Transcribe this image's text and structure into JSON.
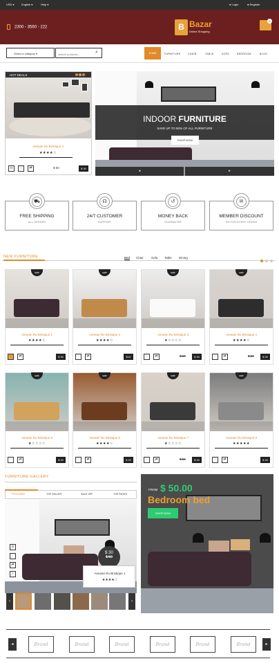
{
  "topbar": {
    "currency": "USD",
    "language": "English",
    "help": "Help",
    "login": "Login",
    "register": "Register"
  },
  "header": {
    "phone": "2300 - 3560 - 222",
    "logo_letter": "B",
    "logo_title": "Bazar",
    "logo_sub": "Online Shopping",
    "cart_count": "0"
  },
  "search": {
    "category": "Select a category",
    "placeholder": "search products..."
  },
  "nav": [
    "HOME",
    "FURNITURE",
    "CHAIR",
    "TABLE",
    "SOFA",
    "BEDROOM",
    "BLOG"
  ],
  "hot_deals": {
    "label": "HOT DEALS",
    "product": "Aenean Ru Bristique 4",
    "stars": "★★★★☆",
    "old_price": "$ 50",
    "price": "$ 30"
  },
  "banner": {
    "title_light": "INDOOR ",
    "title_bold": "FURNITURE",
    "subtitle": "SAVE UP TO 50% OF ALL FURNITURE",
    "button": "SHOP NOW",
    "prev": "◂",
    "next": "▸"
  },
  "features": [
    {
      "icon": "truck-icon",
      "glyph": "⛟",
      "title": "FREE SHIPPING",
      "sub": "ALL ORDERS"
    },
    {
      "icon": "headset-icon",
      "glyph": "☊",
      "title": "24/7 CUSTOMER",
      "sub": "SUPPORT"
    },
    {
      "icon": "refund-icon",
      "glyph": "↺",
      "title": "MONEY BACK",
      "sub": "GUARANTEE"
    },
    {
      "icon": "megaphone-icon",
      "glyph": "✉",
      "title": "MEMBER DISCOUNT",
      "sub": "5% FOR EVERY ORDER"
    }
  ],
  "new_furniture": {
    "title": "NEW FURNITURE",
    "filters": [
      "Bed",
      "Chair",
      "Sofa",
      "Table",
      "Dining"
    ],
    "sale_label": "sale",
    "products": [
      {
        "name": "Aenean Ru Bristique 1",
        "stars": "★★★★☆",
        "old": "",
        "price": "$ 30"
      },
      {
        "name": "Aenean Ru Bristique 2",
        "stars": "★★★★☆",
        "old": "",
        "price": "$10"
      },
      {
        "name": "Aenean Ru Bristique 3",
        "stars": "★☆☆☆☆",
        "old": "$ 50",
        "price": "$ 30"
      },
      {
        "name": "Aenean Ru Bristique 4",
        "stars": "★★★★☆",
        "old": "$ 50",
        "price": "$ 30"
      },
      {
        "name": "Aenean Ru Bristique 5",
        "stars": "★☆☆☆☆",
        "old": "",
        "price": "$ 30"
      },
      {
        "name": "Aenean Ru Bristique 6",
        "stars": "★★★★☆",
        "old": "",
        "price": "$ 30"
      },
      {
        "name": "Aenean Ru Bristique 7",
        "stars": "★☆☆☆☆",
        "old": "$ 50",
        "price": "$ 30"
      },
      {
        "name": "Aenean Ru Bristique 8",
        "stars": "★★★★★",
        "old": "",
        "price": "$ 30"
      }
    ]
  },
  "gallery": {
    "title": "FURNITURE GALLERY",
    "tabs": [
      "FEATURED",
      "TOP SELLER",
      "SALE OFF",
      "TOP RATED"
    ],
    "price": "$ 30",
    "old_price": "$ 50",
    "product": "Aenean Ru Bristique 1",
    "stars": "★★★★☆"
  },
  "promo": {
    "from": "FROM",
    "price": "$ 50.00",
    "name": "Bedroom bed",
    "button": "SHOP NOW"
  },
  "brands": [
    "Brand",
    "Brand",
    "Brand",
    "Brand",
    "Brand",
    "Brand"
  ],
  "colors": {
    "accent": "#e08a2a",
    "header": "#6b1f1f",
    "green": "#2ecc71"
  }
}
